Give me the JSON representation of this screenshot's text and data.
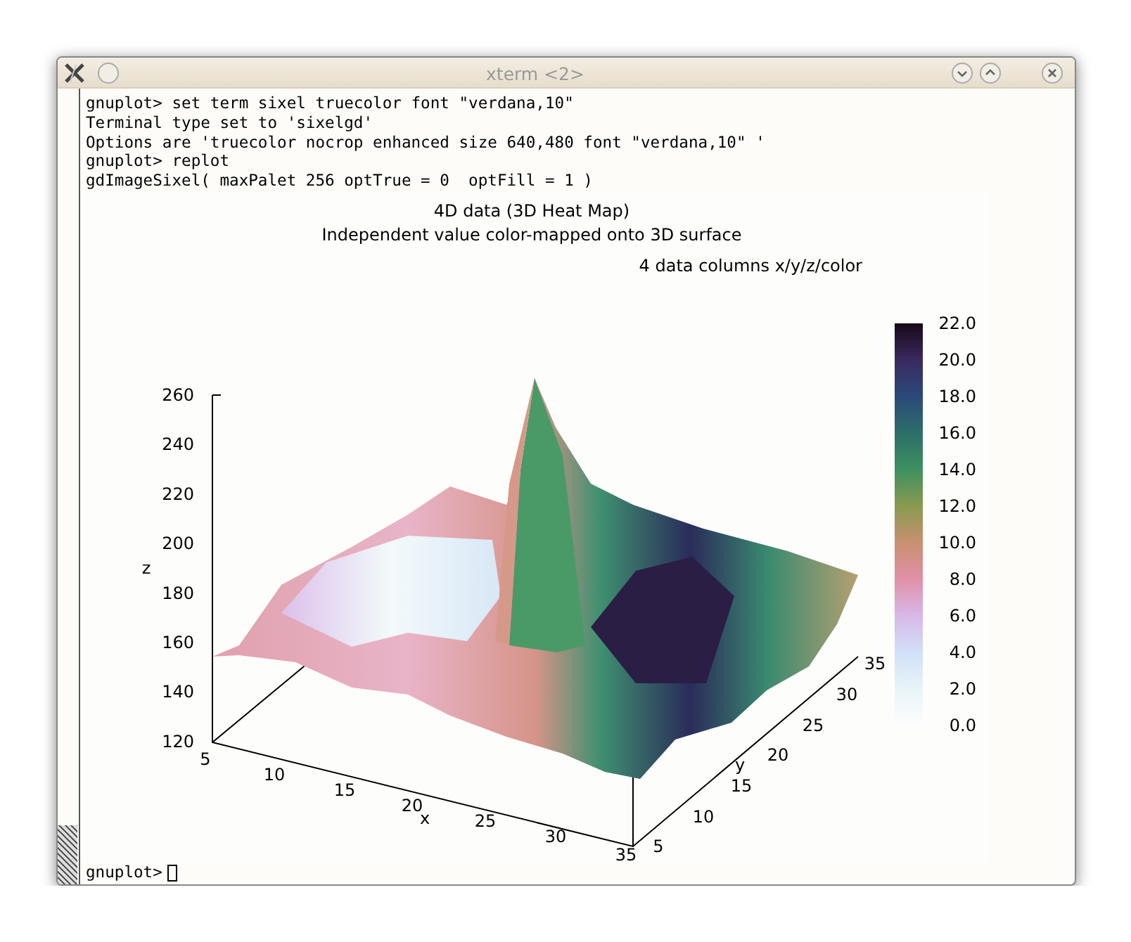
{
  "window": {
    "title": "xterm <2>"
  },
  "terminal": {
    "lines": [
      "gnuplot> set term sixel truecolor font \"verdana,10\"",
      "Terminal type set to 'sixelgd'",
      "Options are 'truecolor nocrop enhanced size 640,480 font \"verdana,10\" '",
      "gnuplot> replot",
      "gdImageSixel( maxPalet 256 optTrue = 0  optFill = 1 )"
    ],
    "prompt": "gnuplot>"
  },
  "plot": {
    "title": "4D data (3D Heat Map)",
    "subtitle": "Independent value color-mapped onto 3D surface",
    "note": "4 data columns x/y/z/color",
    "z_label": "z",
    "z_ticks": [
      "260",
      "240",
      "220",
      "200",
      "180",
      "160",
      "140",
      "120"
    ],
    "x_label": "x",
    "x_ticks": [
      "5",
      "10",
      "15",
      "20",
      "25",
      "30",
      "35"
    ],
    "y_label": "y",
    "y_ticks": [
      "5",
      "10",
      "15",
      "20",
      "25",
      "30",
      "35"
    ],
    "colorbar_ticks": [
      "22.0",
      "20.0",
      "18.0",
      "16.0",
      "14.0",
      "12.0",
      "10.0",
      "8.0",
      "6.0",
      "4.0",
      "2.0",
      "0.0"
    ]
  }
}
